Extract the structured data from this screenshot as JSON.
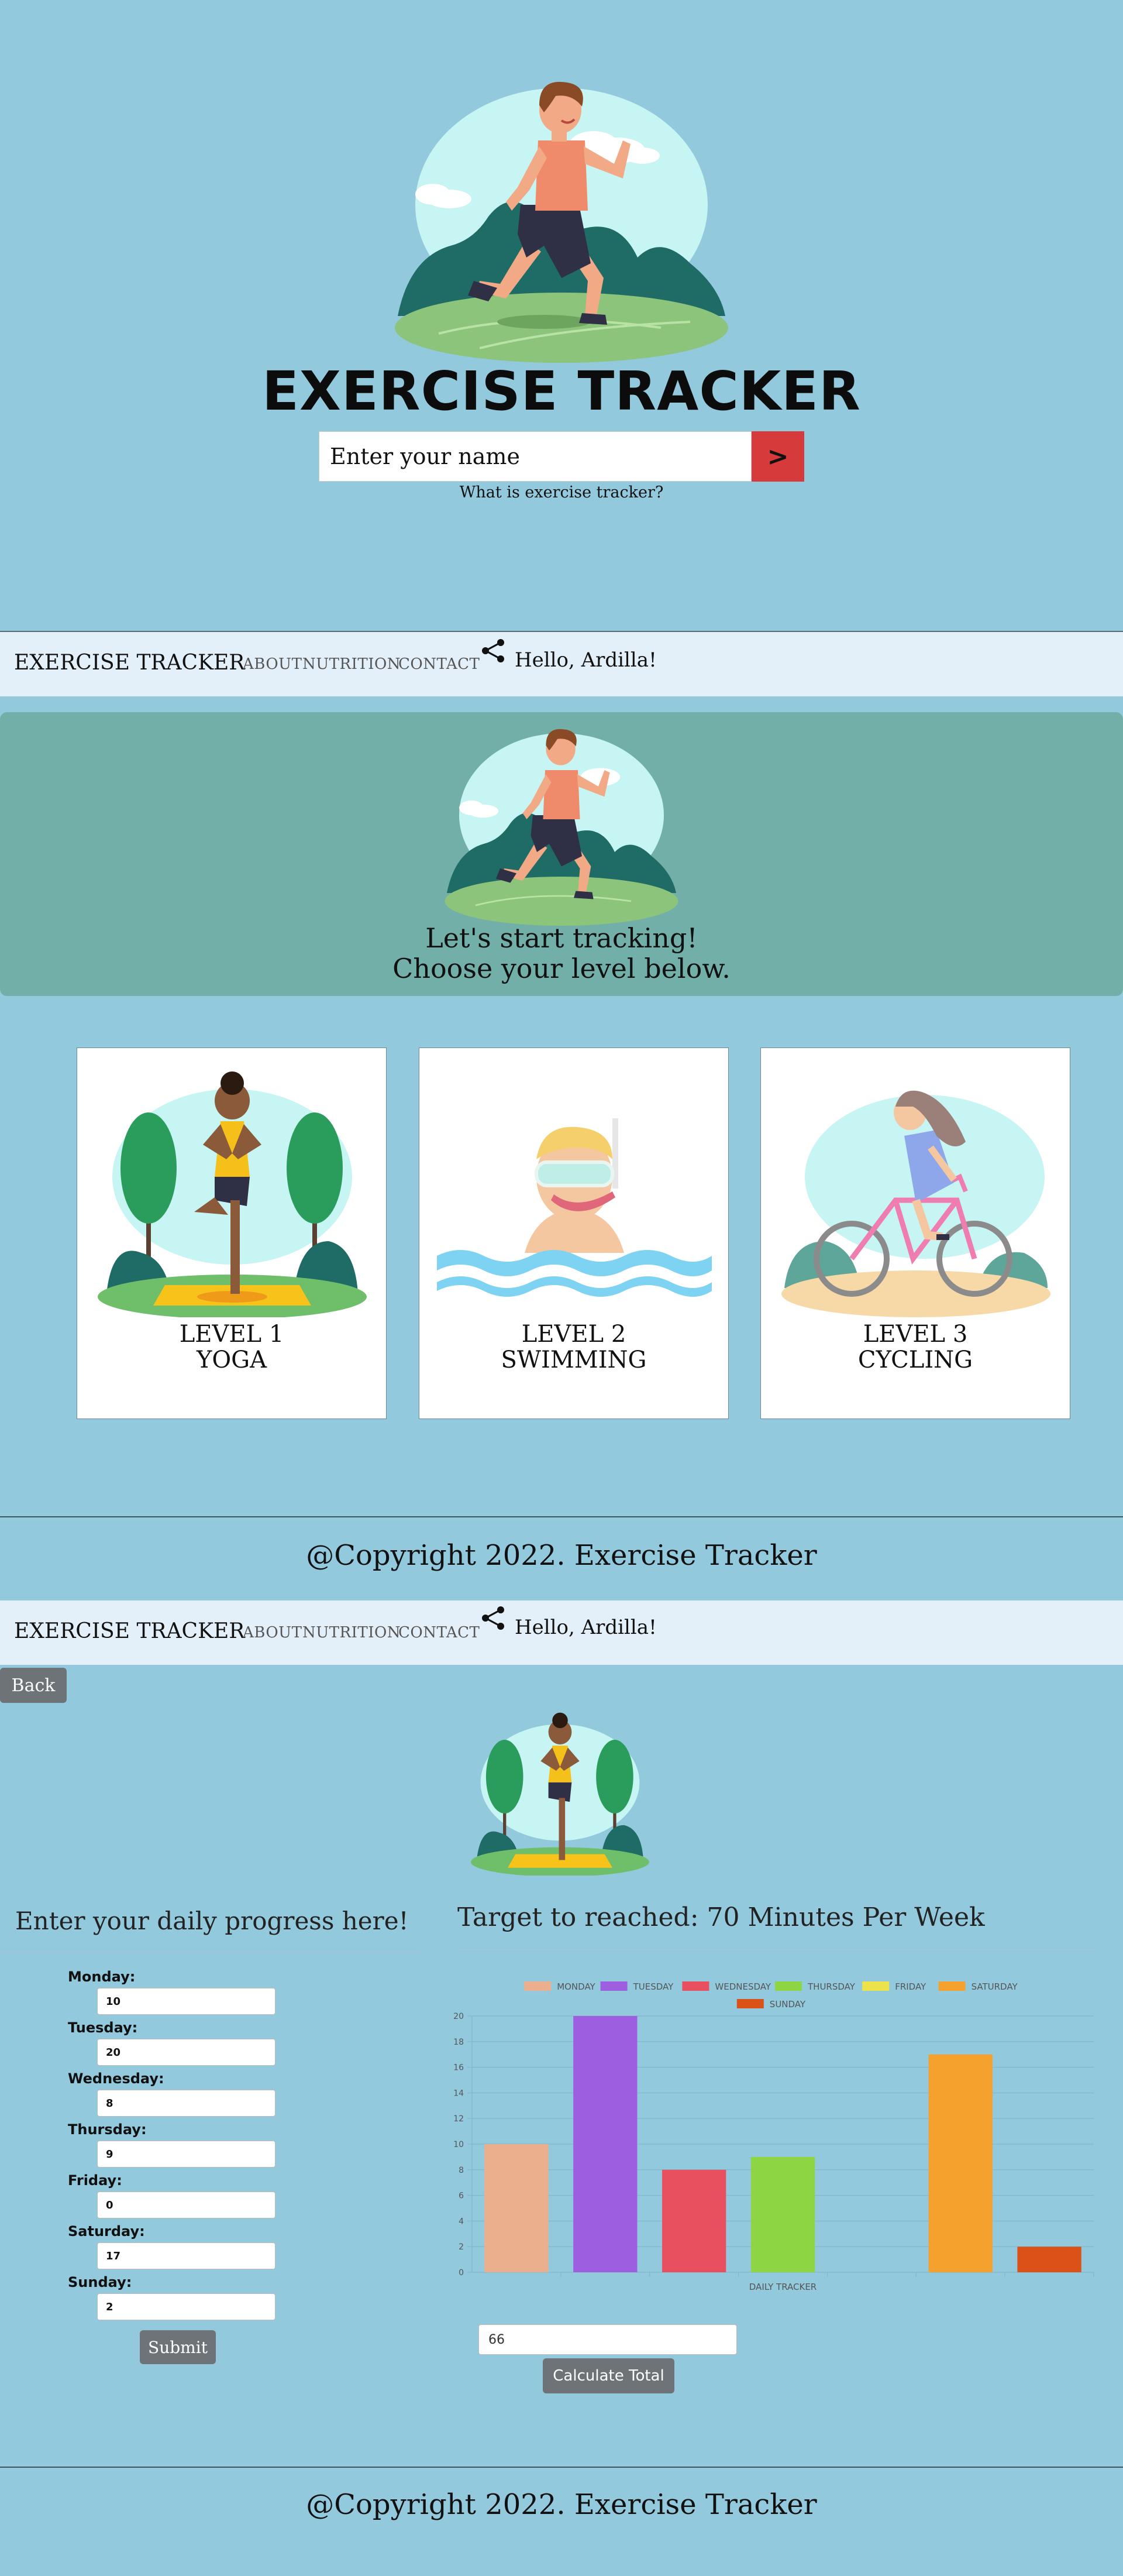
{
  "hero": {
    "title": "EXERCISE TRACKER",
    "name_placeholder": "Enter your name",
    "go_label": ">",
    "link_text": "What is exercise tracker?"
  },
  "navbar": {
    "brand": "EXERCISE TRACKER",
    "links": [
      "ABOUT",
      "NUTRITION",
      "CONTACT"
    ],
    "share_icon": "share-icon",
    "greeting": "Hello, Ardilla!"
  },
  "welcome": {
    "line1": "Let's start tracking!",
    "line2": "Choose your level below."
  },
  "levels": [
    {
      "level": "LEVEL 1",
      "activity": "YOGA"
    },
    {
      "level": "LEVEL 2",
      "activity": "SWIMMING"
    },
    {
      "level": "LEVEL 3",
      "activity": "CYCLING"
    }
  ],
  "footer": {
    "text": "@Copyright 2022. Exercise Tracker"
  },
  "tracker": {
    "back_label": "Back",
    "progress_heading": "Enter your daily progress here!",
    "days": [
      {
        "label": "Monday:",
        "value": "10"
      },
      {
        "label": "Tuesday:",
        "value": "20"
      },
      {
        "label": "Wednesday:",
        "value": "8"
      },
      {
        "label": "Thursday:",
        "value": "9"
      },
      {
        "label": "Friday:",
        "value": "0"
      },
      {
        "label": "Saturday:",
        "value": "17"
      },
      {
        "label": "Sunday:",
        "value": "2"
      }
    ],
    "submit_label": "Submit",
    "target_heading": "Target to reached: 70 Minutes Per Week",
    "total_value": "66",
    "calc_label": "Calculate Total"
  },
  "colors": {
    "background": "#93c9dd",
    "go_button": "#d63a3a",
    "welcome_card": "#72afa8",
    "navbar": "#e3f0fa",
    "button_gray": "#6d7377"
  },
  "chart_data": {
    "type": "bar",
    "categories": [
      "MONDAY",
      "TUESDAY",
      "WEDNESDAY",
      "THURSDAY",
      "FRIDAY",
      "SATURDAY",
      "SUNDAY"
    ],
    "values": [
      10,
      20,
      8,
      9,
      0,
      17,
      2
    ],
    "colors": [
      "#ebaf8d",
      "#9d5fe0",
      "#e8505f",
      "#8dd543",
      "#ede24a",
      "#f4a22d",
      "#db5118"
    ],
    "xlabel": "DAILY TRACKER",
    "ylabel": "",
    "ylim": [
      0,
      20
    ],
    "yticks": [
      "0",
      "2",
      "4",
      "6",
      "8",
      "10",
      "12",
      "14",
      "16",
      "18",
      "20"
    ],
    "legend": "top",
    "grid": true
  }
}
